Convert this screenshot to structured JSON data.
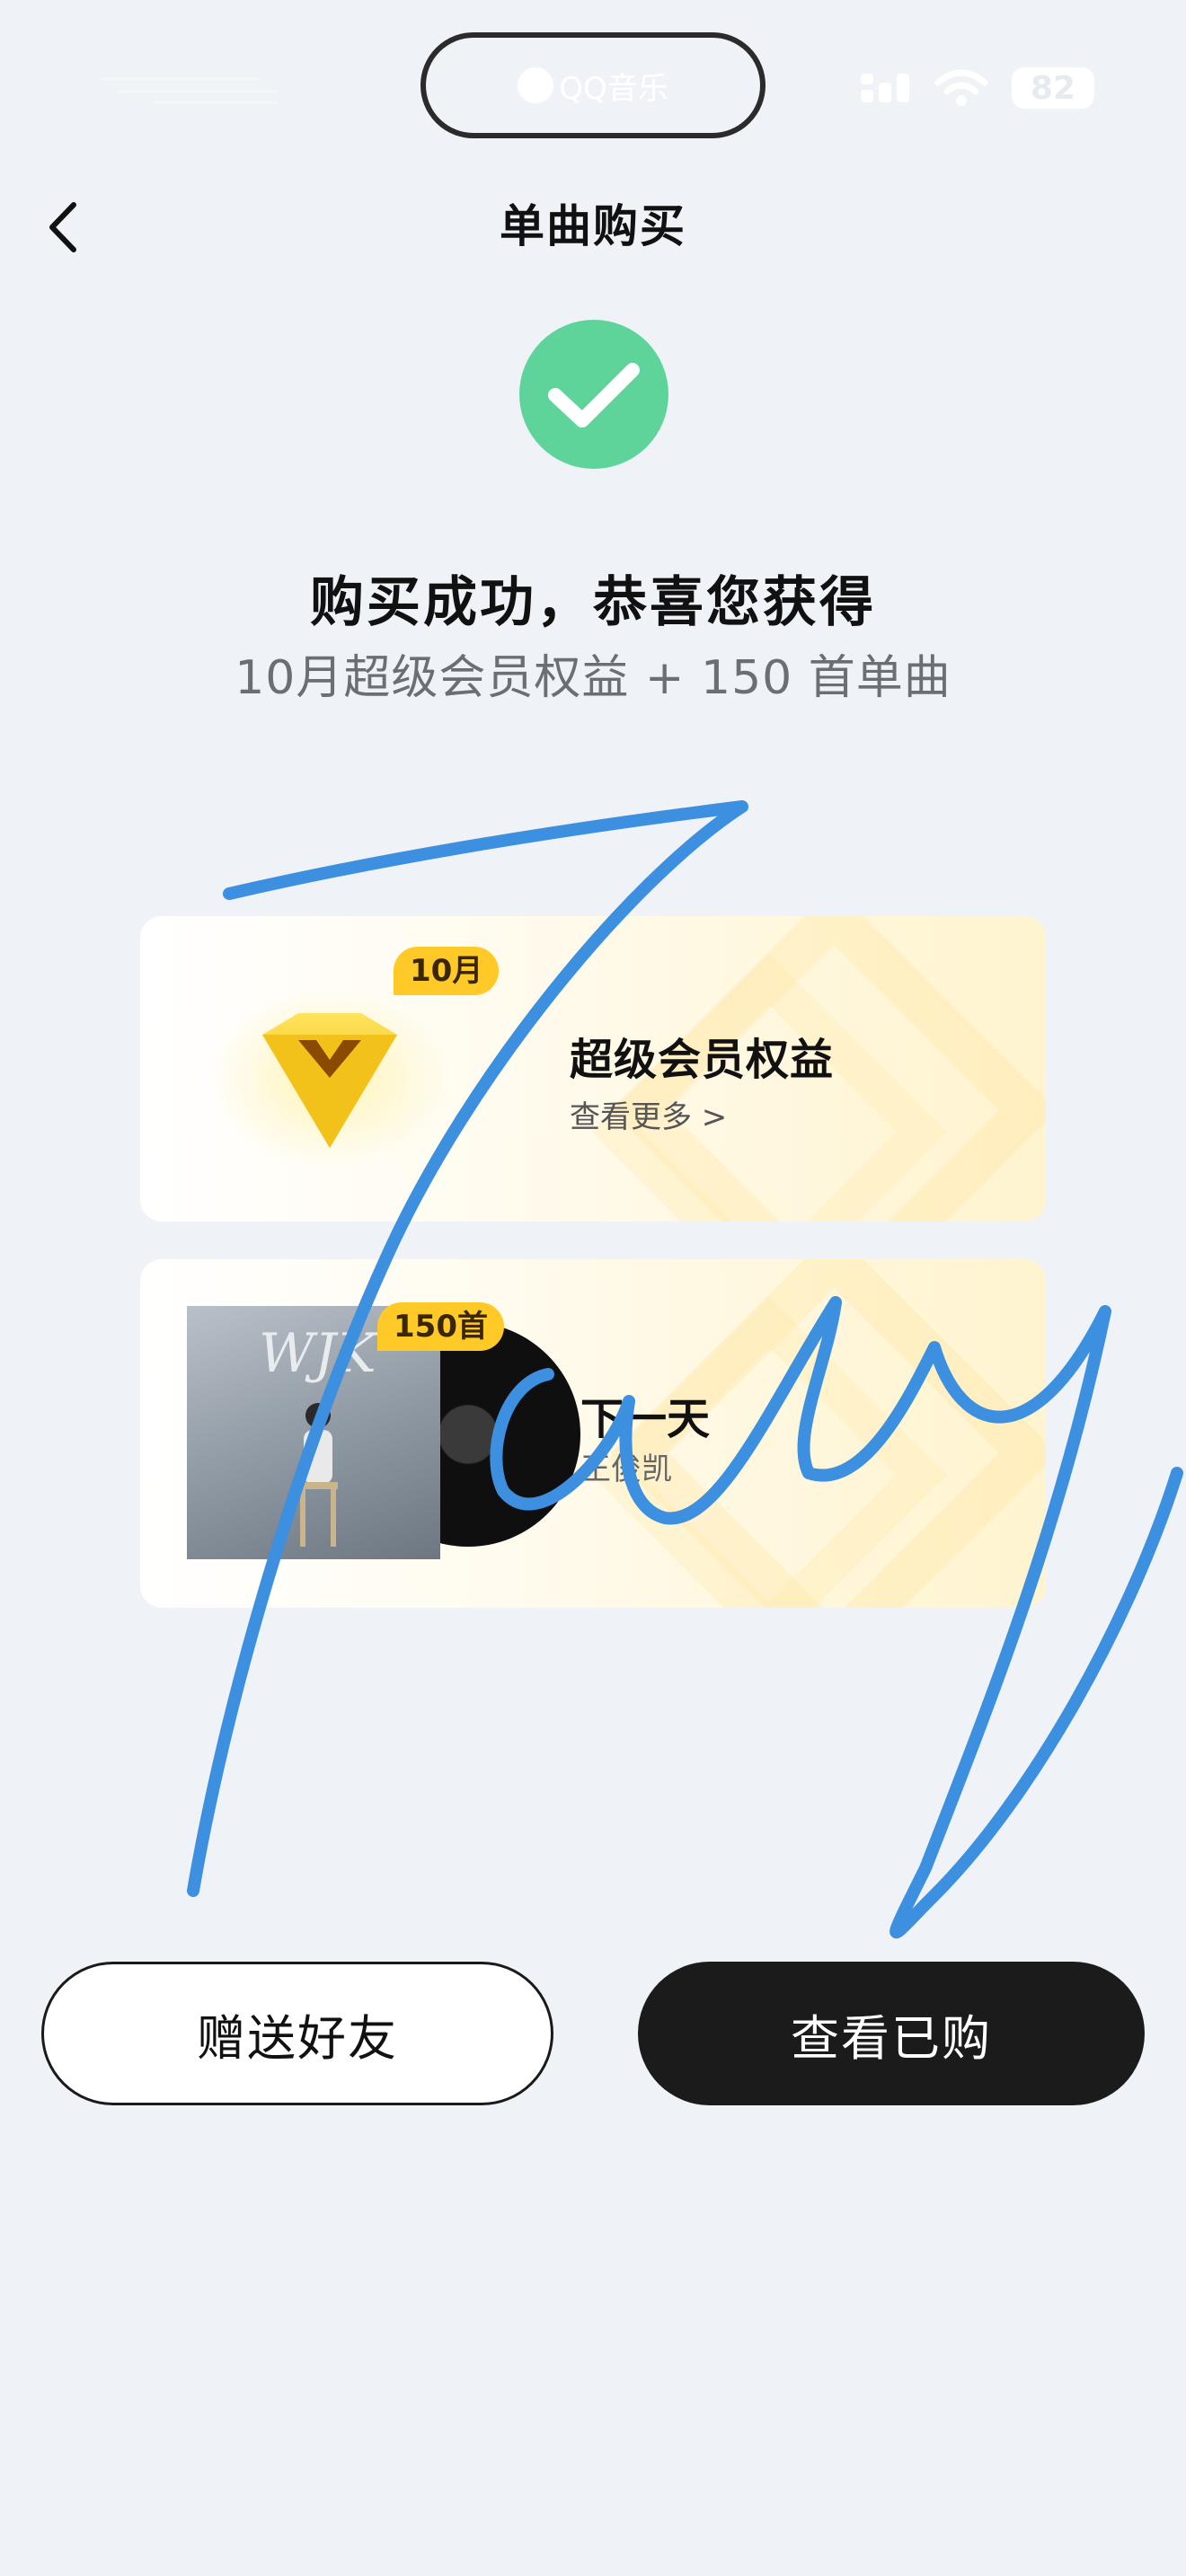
{
  "status_bar": {
    "island_text": "QQ音乐",
    "battery": "82"
  },
  "header": {
    "title": "单曲购买"
  },
  "success": {
    "title": "购买成功，恭喜您获得",
    "subtitle": "10月超级会员权益 + 150 首单曲"
  },
  "vip_card": {
    "badge": "10月",
    "title": "超级会员权益",
    "more": "查看更多 >"
  },
  "song_card": {
    "badge": "150首",
    "cover_text": "WJK",
    "title": "下一天",
    "artist": "王俊凯"
  },
  "actions": {
    "gift_label": "赠送好友",
    "view_label": "查看已购"
  },
  "colors": {
    "success": "#5fd49a",
    "badge": "#ffc928",
    "signature": "#3d8fe0",
    "primary_button": "#1b1b1b"
  }
}
